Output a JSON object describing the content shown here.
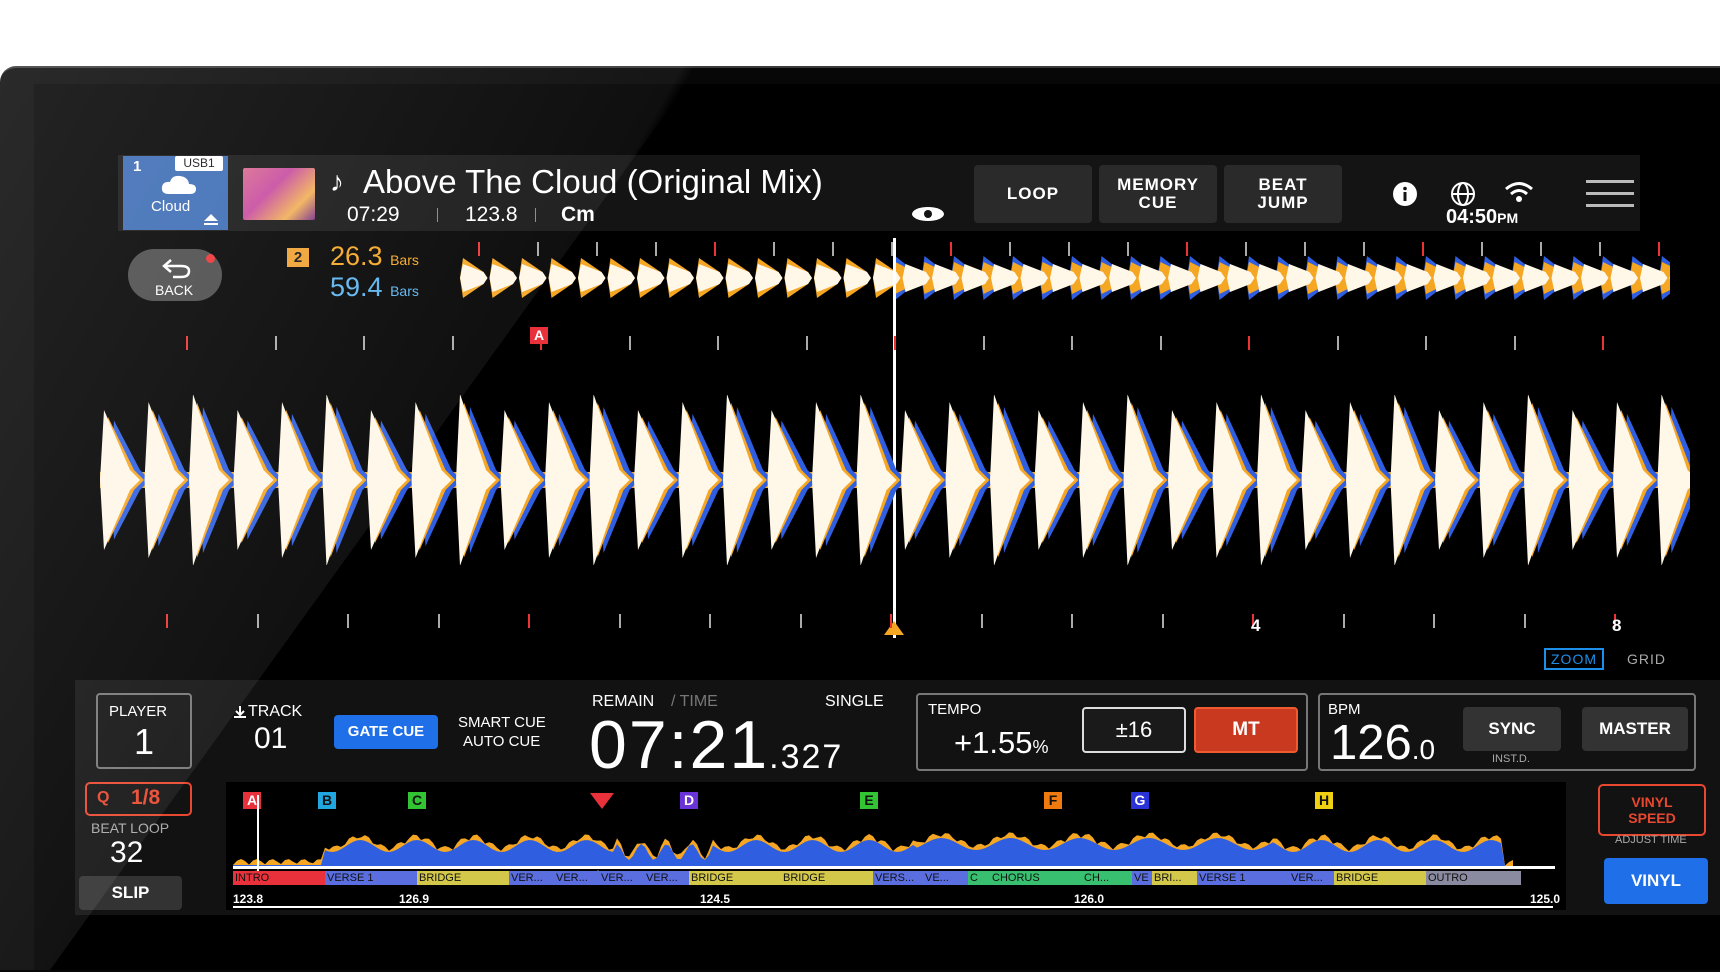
{
  "header": {
    "deck_number": "1",
    "source": "USB1",
    "source_label": "Cloud",
    "track_title": "Above The Cloud (Original Mix)",
    "duration": "07:29",
    "bpm": "123.8",
    "key": "Cm"
  },
  "mode_buttons": [
    {
      "label": "LOOP"
    },
    {
      "label": "MEMORY\nCUE"
    },
    {
      "label": "BEAT\nJUMP"
    }
  ],
  "status": {
    "time": "04:50",
    "ampm": "PM"
  },
  "back": {
    "label": "BACK",
    "slot": "2",
    "bars1": "26.3",
    "bars1_unit": "Bars",
    "bars2": "59.4",
    "bars2_unit": "Bars"
  },
  "waveform": {
    "beat_labels": [
      "4",
      "8"
    ],
    "hot_cue_top": "A",
    "zoom_label": "ZOOM",
    "grid_label": "GRID"
  },
  "player": {
    "player_label": "PLAYER",
    "player_value": "1",
    "track_label": "TRACK",
    "track_value": "01",
    "gate_cue": "GATE CUE",
    "smart_cue": "SMART CUE",
    "auto_cue": "AUTO CUE",
    "remain_label": "REMAIN",
    "time_label": "/ TIME",
    "single_label": "SINGLE",
    "remain_main": "07:21",
    "remain_ms": ".327",
    "tempo_label": "TEMPO",
    "tempo_value": "+1.55",
    "tempo_unit": "%",
    "tempo_range": "±16",
    "mt": "MT",
    "bpm_label": "BPM",
    "bpm_main": "126",
    "bpm_dec": ".0",
    "sync": "SYNC",
    "inst_d": "INST.D.",
    "master": "MASTER",
    "quantize_label": "Q",
    "quantize_value": "1/8",
    "beat_loop_label": "BEAT LOOP",
    "beat_loop_value": "32",
    "slip": "SLIP",
    "vinyl_speed": "VINYL\nSPEED",
    "adjust_time": "ADJUST TIME",
    "vinyl": "VINYL"
  },
  "overview": {
    "cues": [
      "A",
      "B",
      "C",
      "D",
      "E",
      "F",
      "G",
      "H"
    ],
    "segments": [
      "INTRO",
      "VERSE 1",
      "BRIDGE",
      "VER...",
      "VER...",
      "VER...",
      "VER...",
      "BRIDGE",
      "BRIDGE",
      "VERS...",
      "VE...",
      "C",
      "CHORUS",
      "CH...",
      "VE",
      "BRI...",
      "VERSE 1",
      "VER...",
      "BRIDGE",
      "OUTRO"
    ],
    "bpm_ticks": [
      "123.8",
      "126.9",
      "124.5",
      "126.0",
      "125.0"
    ]
  },
  "colors": {
    "orange": "#f5a623",
    "blue": "#2f5fe0",
    "white_wave": "#fff7e8",
    "accent_blue": "#1e6fe8",
    "mt_red": "#c8391f",
    "cloud_blue": "#3b6bb4"
  }
}
